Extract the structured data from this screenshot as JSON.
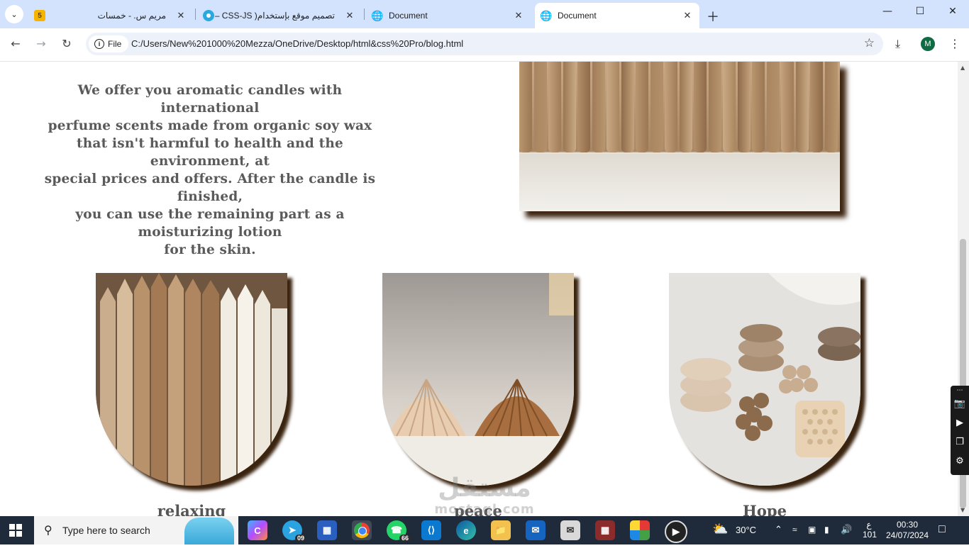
{
  "browser": {
    "tabs": [
      {
        "title": "مريم س. - خمسات",
        "favicon": "5",
        "active": false
      },
      {
        "title": "تصميم موقع بإستخدام( CSS-JS –",
        "favicon": "",
        "active": false
      },
      {
        "title": "Document",
        "favicon": "",
        "active": false
      },
      {
        "title": "Document",
        "favicon": "",
        "active": true
      }
    ],
    "chip_label": "File",
    "url": "C:/Users/New%201000%20Mezza/OneDrive/Desktop/html&css%20Pro/blog.html",
    "profile_initial": "M"
  },
  "page": {
    "intro_lines": [
      "We offer you aromatic candles with international",
      "perfume scents made from organic soy wax",
      "that isn't harmful to health and the environment, at",
      "special prices and offers. After the candle is finished,",
      "you can use the remaining part as a moisturizing lotion",
      "for the skin."
    ],
    "cards": [
      {
        "label": "relaxing"
      },
      {
        "label": "peace"
      },
      {
        "label": "Hope"
      }
    ]
  },
  "watermark": {
    "big": "مستقل",
    "small": "mostaql.com"
  },
  "taskbar": {
    "search_placeholder": "Type here to search",
    "telegram_badge": "09",
    "whatsapp_badge": "66",
    "temperature": "30°C",
    "lang_line1": "ع",
    "lang_line2": "101",
    "time": "00:30",
    "date": "24/07/2024"
  }
}
